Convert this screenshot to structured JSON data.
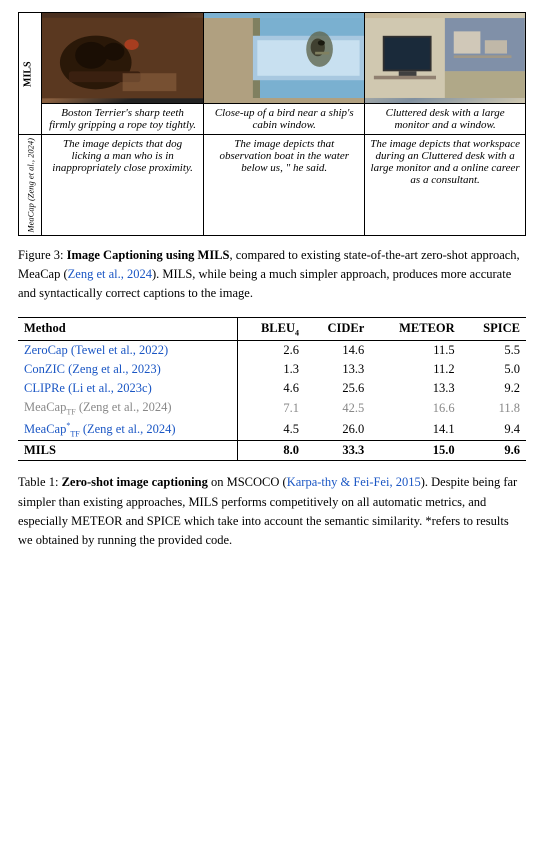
{
  "figure": {
    "images": [
      {
        "id": "img-dog",
        "alt": "Boston Terrier dog gripping rope toy",
        "style": "img-dog"
      },
      {
        "id": "img-bird",
        "alt": "Bird near ship cabin window",
        "style": "img-bird"
      },
      {
        "id": "img-desk",
        "alt": "Cluttered desk with monitor and window",
        "style": "img-desk"
      }
    ],
    "mils_label": "MILS",
    "mils_captions": [
      "Boston Terrier's sharp teeth firmly gripping a rope toy tightly.",
      "Close-up of a bird near a ship's cabin window.",
      "Cluttered desk with a large monitor and a window."
    ],
    "meacap_label": "MeaCap (Zeng et al., 2024)",
    "meacap_captions": [
      "The image depicts that dog licking a man who is in inappropriately close proximity.",
      "The image depicts that observation boat in the water below us, \" he said.",
      "The image depicts that workspace during an Cluttered desk with a large monitor and a online career as a consultant."
    ]
  },
  "figure_caption": {
    "number": "Figure 3:",
    "bold_text": "Image Captioning using MILS",
    "rest": ", compared to existing state-of-the-art zero-shot approach, MeaCap (",
    "link1": "Zeng et al., 2024",
    "rest2": "). MILS, while being a much simpler approach, produces more accurate and syntactically correct captions to the image."
  },
  "results_table": {
    "columns": [
      "Method",
      "BLEU₄",
      "CIDEr",
      "METEOR",
      "SPICE"
    ],
    "rows": [
      {
        "method": "ZeroCap (Tewel et al., 2022)",
        "bleu": "2.6",
        "cider": "14.6",
        "meteor": "11.5",
        "spice": "5.5",
        "gray": false,
        "link": true
      },
      {
        "method": "ConZIC (Zeng et al., 2023)",
        "bleu": "1.3",
        "cider": "13.3",
        "meteor": "11.2",
        "spice": "5.0",
        "gray": false,
        "link": true
      },
      {
        "method": "CLIPRe (Li et al., 2023c)",
        "bleu": "4.6",
        "cider": "25.6",
        "meteor": "13.3",
        "spice": "9.2",
        "gray": false,
        "link": true
      },
      {
        "method": "MeaCapTF (Zeng et al., 2024)",
        "bleu": "7.1",
        "cider": "42.5",
        "meteor": "16.6",
        "spice": "11.8",
        "gray": true,
        "link": true,
        "sub": "TF"
      },
      {
        "method": "MeaCap*TF (Zeng et al., 2024)",
        "bleu": "4.5",
        "cider": "26.0",
        "meteor": "14.1",
        "spice": "9.4",
        "gray": false,
        "link": true,
        "sub": "*TF"
      }
    ],
    "mils_row": {
      "method": "MILS",
      "bleu": "8.0",
      "cider": "33.3",
      "meteor": "15.0",
      "spice": "9.6"
    }
  },
  "table_caption": {
    "number": "Table 1:",
    "bold_text": "Zero-shot image captioning",
    "rest": " on MSCOCO (",
    "link": "Karpa-thy & Fei-Fei, 2015",
    "rest2": "). Despite being far simpler than existing approaches, MILS performs competitively on all automatic metrics, and especially METEOR and SPICE which take into account the semantic similarity. *refers to results we obtained by running the provided code."
  }
}
